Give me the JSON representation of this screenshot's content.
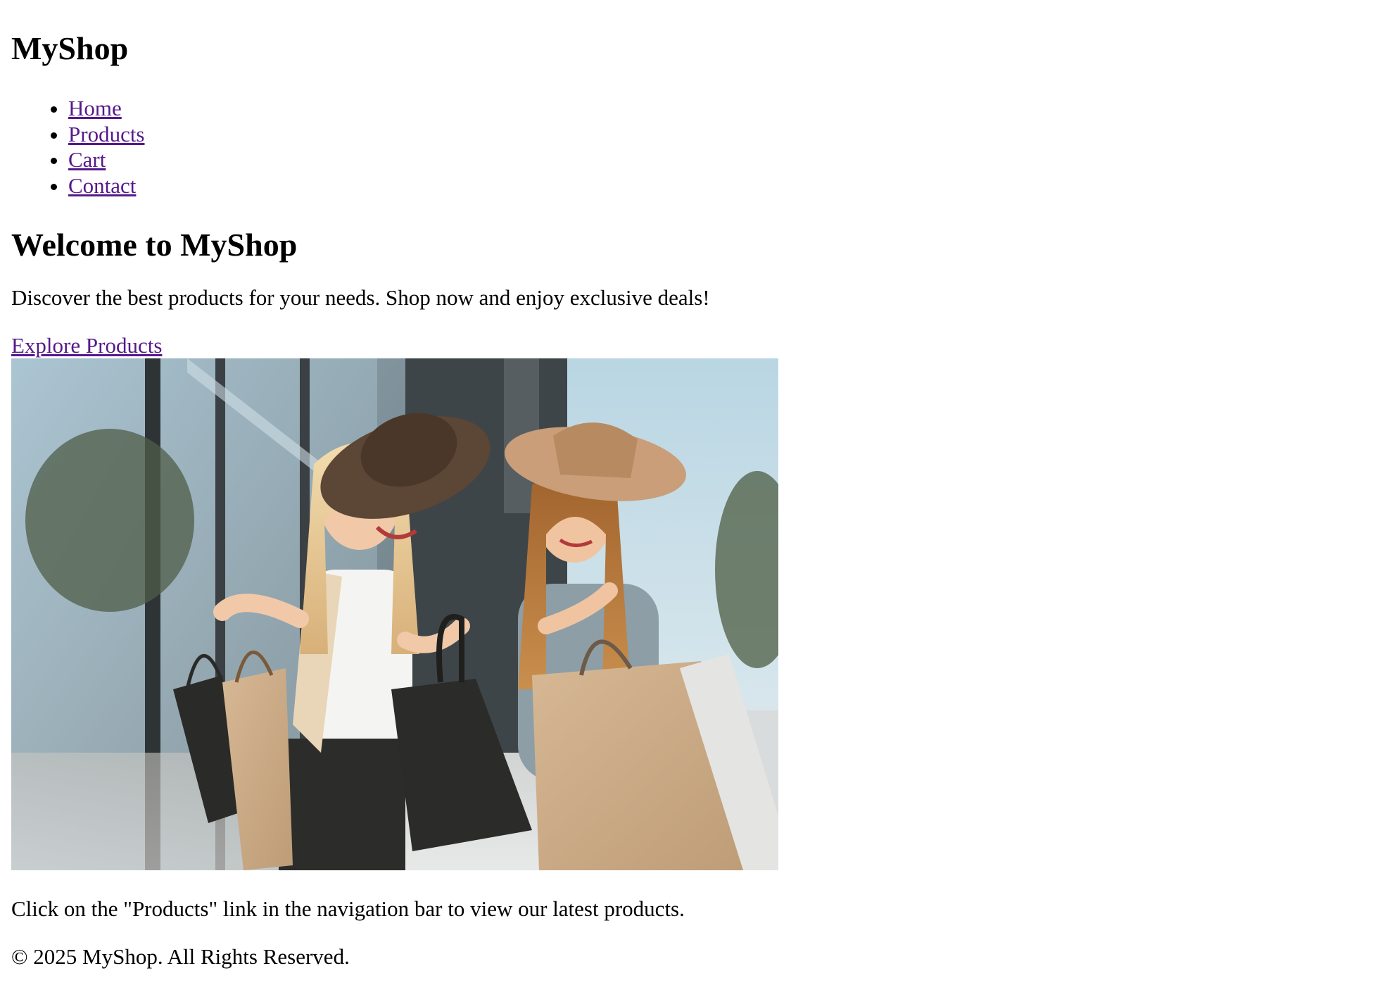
{
  "site": {
    "title": "MyShop"
  },
  "nav": {
    "items": [
      {
        "label": "Home"
      },
      {
        "label": "Products"
      },
      {
        "label": "Cart"
      },
      {
        "label": "Contact"
      }
    ],
    "link_color": "#551a8b"
  },
  "hero": {
    "title": "Welcome to MyShop",
    "text": "Discover the best products for your needs. Shop now and enjoy exclusive deals!",
    "cta_label": "Explore Products",
    "image_alt": "Two women with shopping bags"
  },
  "hint": {
    "text": "Click on the \"Products\" link in the navigation bar to view our latest products."
  },
  "footer": {
    "text": "© 2025 MyShop. All Rights Reserved."
  }
}
